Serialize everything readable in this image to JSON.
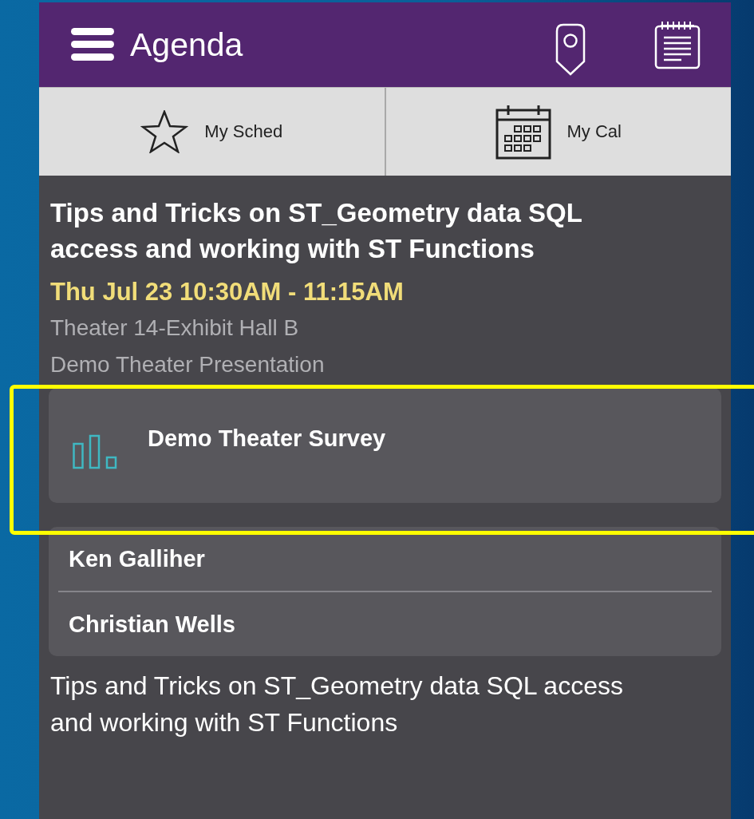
{
  "app_bar": {
    "title": "Agenda"
  },
  "tabs": [
    {
      "label": "My Sched"
    },
    {
      "label": "My Cal"
    }
  ],
  "session": {
    "title": "Tips and Tricks on ST_Geometry data SQL access and working with ST Functions",
    "time": "Thu Jul 23 10:30AM - 11:15AM",
    "location": "Theater 14-Exhibit Hall B",
    "type": "Demo Theater Presentation"
  },
  "survey": {
    "label": "Demo Theater Survey",
    "highlighted": true
  },
  "speakers": [
    "Ken Galliher",
    "Christian Wells"
  ],
  "description": "Tips and Tricks on ST_Geometry data SQL access and working with ST Functions"
}
